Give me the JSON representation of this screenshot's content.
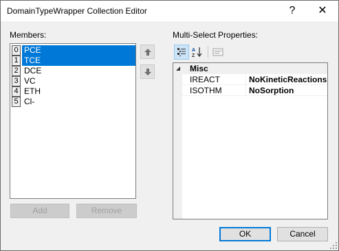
{
  "window": {
    "title": "DomainTypeWrapper Collection Editor",
    "help_glyph": "?",
    "close_glyph": "✕"
  },
  "members": {
    "label": "Members:",
    "items": [
      {
        "index": "0",
        "name": "PCE",
        "selected": true
      },
      {
        "index": "1",
        "name": "TCE",
        "selected": true
      },
      {
        "index": "2",
        "name": "DCE",
        "selected": false
      },
      {
        "index": "3",
        "name": "VC",
        "selected": false
      },
      {
        "index": "4",
        "name": "ETH",
        "selected": false
      },
      {
        "index": "5",
        "name": "Cl-",
        "selected": false
      }
    ],
    "add_label": "Add",
    "remove_label": "Remove"
  },
  "properties": {
    "label": "Multi-Select Properties:",
    "category": "Misc",
    "rows": [
      {
        "name": "IREACT",
        "value": "NoKineticReactions"
      },
      {
        "name": "ISOTHM",
        "value": "NoSorption"
      }
    ]
  },
  "footer": {
    "ok_label": "OK",
    "cancel_label": "Cancel"
  },
  "colors": {
    "selection": "#0078d7",
    "face": "#f0f0f0"
  },
  "icons": [
    "move-up-icon",
    "move-down-icon",
    "categorized-icon",
    "alphabetical-icon",
    "property-pages-icon",
    "resize-grip-icon"
  ]
}
